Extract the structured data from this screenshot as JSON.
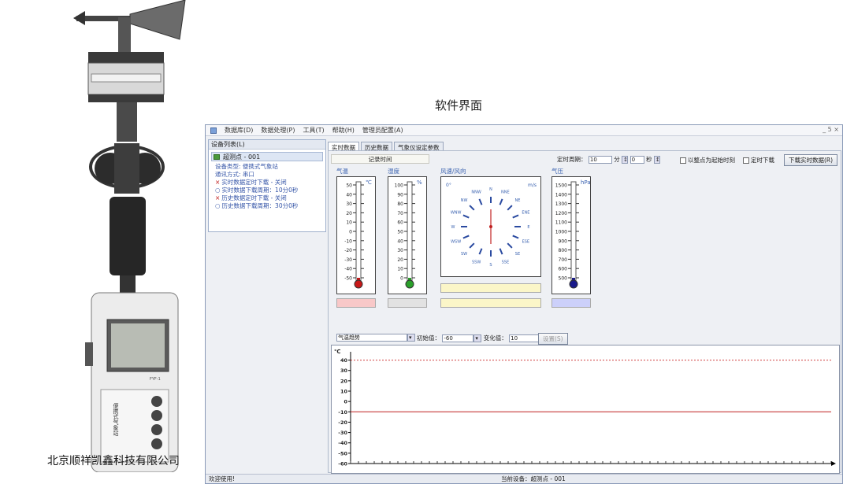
{
  "page_title": "软件界面",
  "company": "北京顺祥凯鑫科技有限公司",
  "device": {
    "model": "FYF-1",
    "panel_text": "便携式气象站"
  },
  "menu": [
    "数据库(D)",
    "数据处理(P)",
    "工具(T)",
    "帮助(H)",
    "管理员配置(A)"
  ],
  "window_controls": "_ 5 ×",
  "left": {
    "header": "设备列表(L)",
    "node": "超测点 - 001",
    "info": [
      {
        "text": "设备类型: 便携式气象站",
        "kind": "plain"
      },
      {
        "text": "通讯方式: 串口",
        "kind": "plain"
      },
      {
        "text": "实时数据定时下载 - 关闭",
        "kind": "r"
      },
      {
        "text": "实时数据下载周期：10分0秒",
        "kind": "b"
      },
      {
        "text": "历史数据定时下载 - 关闭",
        "kind": "r"
      },
      {
        "text": "历史数据下载周期：30分0秒",
        "kind": "b"
      }
    ]
  },
  "tabs": [
    "实时数据",
    "历史数据",
    "气象仪设定参数"
  ],
  "realtime": {
    "record_time_label": "记录时间",
    "period_label": "定时周期：",
    "period_min": "10",
    "min_unit": "分",
    "period_sec": "0",
    "sec_unit": "秒",
    "chk_integer": "以整点为起始时刻",
    "chk_timed": "定时下载",
    "download_button": "下载实时数据(R)"
  },
  "gauges": {
    "temp": {
      "label": "气温",
      "unit": "℃",
      "ticks": [
        "50",
        "40",
        "30",
        "20",
        "10",
        "0",
        "-10",
        "-20",
        "-30",
        "-40",
        "-50"
      ],
      "fill": 0.0
    },
    "hum": {
      "label": "湿度",
      "unit": "%",
      "ticks": [
        "100",
        "90",
        "80",
        "70",
        "60",
        "50",
        "40",
        "30",
        "20",
        "10",
        "0"
      ],
      "fill": 0.0
    },
    "wind": {
      "label": "风速/风向",
      "speed_label": "0°",
      "dirs": [
        "N",
        "NNE",
        "NE",
        "ENE",
        "E",
        "ESE",
        "SE",
        "SSE",
        "S",
        "SSW",
        "SW",
        "WSW",
        "W",
        "WNW",
        "NW",
        "NNW"
      ],
      "unit": "m/s"
    },
    "press": {
      "label": "气压",
      "unit": "hPa",
      "ticks": [
        "1500",
        "1400",
        "1300",
        "1200",
        "1100",
        "1000",
        "900",
        "800",
        "700",
        "600",
        "500"
      ],
      "fill": 0.0
    }
  },
  "trend": {
    "series_select": "气温趋势",
    "init_label": "初始值：",
    "init_value": "-60",
    "step_label": "变化值：",
    "step_value": "10",
    "set_button": "设置(S)"
  },
  "status": {
    "left": "欢迎使用!",
    "center": "当前设备：超测点 - 001"
  },
  "chart_data": {
    "type": "line",
    "ylabel": "℃",
    "y_ticks": [
      40,
      30,
      20,
      10,
      0,
      -10,
      -20,
      -30,
      -40,
      -50,
      -60
    ],
    "ylim": [
      -60,
      45
    ],
    "upper_limit": 40,
    "lower_limit": -10,
    "series": [],
    "colors": {
      "upper": "#d04040",
      "lower": "#c02020"
    }
  }
}
